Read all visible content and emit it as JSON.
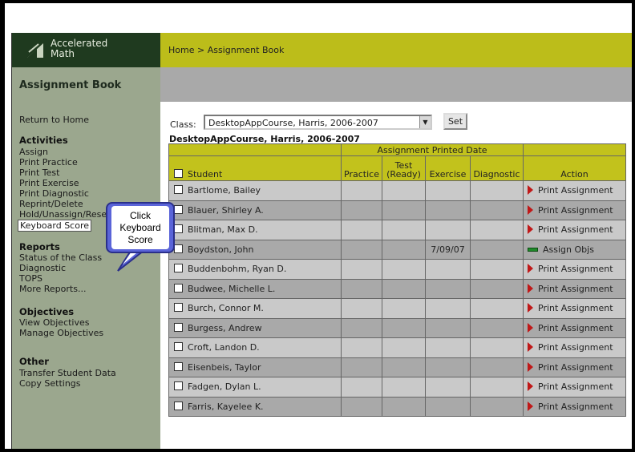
{
  "app": {
    "logo_line1": "Accelerated",
    "logo_line2": "Math",
    "breadcrumb": "Home > Assignment Book",
    "page_title": "Assignment Book"
  },
  "sidebar": {
    "return_home": "Return to Home",
    "activities_heading": "Activities",
    "activities": [
      "Assign",
      "Print Practice",
      "Print Test",
      "Print Exercise",
      "Print Diagnostic",
      "Reprint/Delete",
      "Hold/Unassign/Reset",
      "Keyboard Score"
    ],
    "reports_heading": "Reports",
    "reports": [
      "Status of the Class",
      "Diagnostic",
      "TOPS",
      "More Reports..."
    ],
    "objectives_heading": "Objectives",
    "objectives": [
      "View Objectives",
      "Manage Objectives"
    ],
    "other_heading": "Other",
    "other": [
      "Transfer Student Data",
      "Copy Settings"
    ]
  },
  "content": {
    "class_label": "Class:",
    "class_value": "DesktopAppCourse, Harris, 2006-2007",
    "set_label": "Set",
    "course_heading": "DesktopAppCourse, Harris, 2006-2007"
  },
  "table": {
    "group_header": "Assignment Printed Date",
    "headers": {
      "student": "Student",
      "practice": "Practice",
      "test_line1": "Test",
      "test_line2": "(Ready)",
      "exercise": "Exercise",
      "diagnostic": "Diagnostic",
      "action": "Action"
    },
    "rows": [
      {
        "student": "Bartlome, Bailey",
        "practice": "",
        "test": "",
        "exercise": "",
        "diagnostic": "",
        "action": "Print Assignment",
        "icon": "play-icon"
      },
      {
        "student": "Blauer, Shirley A.",
        "practice": "",
        "test": "",
        "exercise": "",
        "diagnostic": "",
        "action": "Print Assignment",
        "icon": "play-icon"
      },
      {
        "student": "Blitman, Max D.",
        "practice": "",
        "test": "",
        "exercise": "",
        "diagnostic": "",
        "action": "Print Assignment",
        "icon": "play-icon"
      },
      {
        "student": "Boydston, John",
        "practice": "",
        "test": "",
        "exercise": "7/09/07",
        "diagnostic": "",
        "action": "Assign Objs",
        "icon": "bar-icon"
      },
      {
        "student": "Buddenbohm, Ryan D.",
        "practice": "",
        "test": "",
        "exercise": "",
        "diagnostic": "",
        "action": "Print Assignment",
        "icon": "play-icon"
      },
      {
        "student": "Budwee, Michelle L.",
        "practice": "",
        "test": "",
        "exercise": "",
        "diagnostic": "",
        "action": "Print Assignment",
        "icon": "play-icon"
      },
      {
        "student": "Burch, Connor M.",
        "practice": "",
        "test": "",
        "exercise": "",
        "diagnostic": "",
        "action": "Print Assignment",
        "icon": "play-icon"
      },
      {
        "student": "Burgess, Andrew",
        "practice": "",
        "test": "",
        "exercise": "",
        "diagnostic": "",
        "action": "Print Assignment",
        "icon": "play-icon"
      },
      {
        "student": "Croft, Landon D.",
        "practice": "",
        "test": "",
        "exercise": "",
        "diagnostic": "",
        "action": "Print Assignment",
        "icon": "play-icon"
      },
      {
        "student": "Eisenbeis, Taylor",
        "practice": "",
        "test": "",
        "exercise": "",
        "diagnostic": "",
        "action": "Print Assignment",
        "icon": "play-icon"
      },
      {
        "student": "Fadgen, Dylan L.",
        "practice": "",
        "test": "",
        "exercise": "",
        "diagnostic": "",
        "action": "Print Assignment",
        "icon": "play-icon"
      },
      {
        "student": "Farris, Kayelee K.",
        "practice": "",
        "test": "",
        "exercise": "",
        "diagnostic": "",
        "action": "Print Assignment",
        "icon": "play-icon"
      }
    ]
  },
  "callout": {
    "line1": "Click",
    "line2": "Keyboard",
    "line3": "Score"
  },
  "colors": {
    "topbar": "#bcbd1a",
    "logo_bg": "#1f3a1f",
    "sidebar_bg": "#9ba78e",
    "header_gray": "#a9a9a9",
    "callout_border": "#5a64d8",
    "action_icon_red": "#c01818",
    "assign_icon_green": "#1f8a2a"
  }
}
